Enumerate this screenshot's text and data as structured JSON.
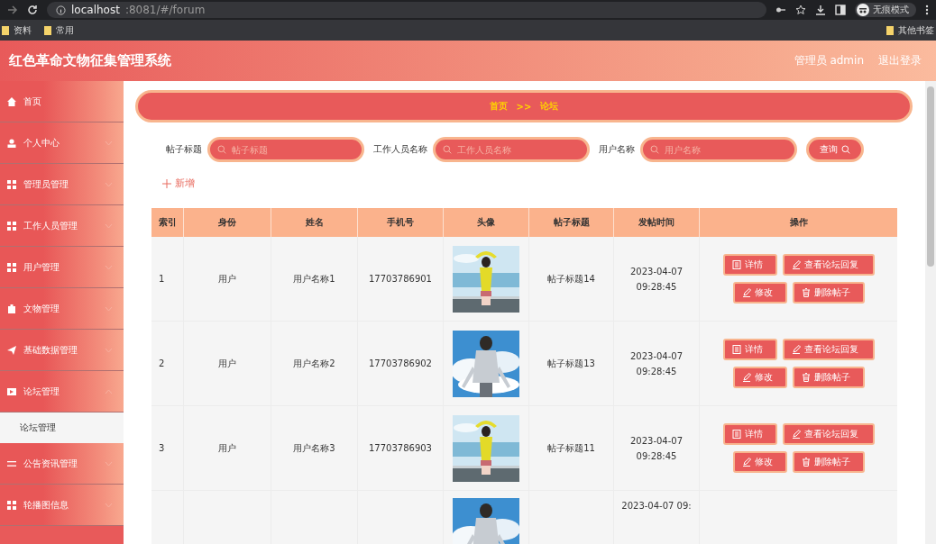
{
  "browser": {
    "url_host": "localhost",
    "url_rest": ":8081/#/forum",
    "mode_label": "无痕模式",
    "bookmarks": [
      "资料",
      "常用"
    ],
    "other_bookmarks": "其他书签"
  },
  "header": {
    "title": "红色革命文物征集管理系统",
    "user": "管理员 admin",
    "logout": "退出登录"
  },
  "sidebar": {
    "items": [
      {
        "label": "首页",
        "has_submenu": false
      },
      {
        "label": "个人中心",
        "has_submenu": true,
        "expanded": false
      },
      {
        "label": "管理员管理",
        "has_submenu": true,
        "expanded": false
      },
      {
        "label": "工作人员管理",
        "has_submenu": true,
        "expanded": false
      },
      {
        "label": "用户管理",
        "has_submenu": true,
        "expanded": false
      },
      {
        "label": "文物管理",
        "has_submenu": true,
        "expanded": false
      },
      {
        "label": "基础数据管理",
        "has_submenu": true,
        "expanded": false
      },
      {
        "label": "论坛管理",
        "has_submenu": true,
        "expanded": true,
        "children": [
          {
            "label": "论坛管理",
            "selected": true
          }
        ]
      },
      {
        "label": "公告资讯管理",
        "has_submenu": true,
        "expanded": false
      },
      {
        "label": "轮播图信息",
        "has_submenu": true,
        "expanded": false
      }
    ]
  },
  "breadcrumb": {
    "items": [
      "首页",
      "论坛"
    ],
    "separator": ">>"
  },
  "search": {
    "fields": [
      {
        "label": "帖子标题",
        "placeholder": "帖子标题"
      },
      {
        "label": "工作人员名称",
        "placeholder": "工作人员名称"
      },
      {
        "label": "用户名称",
        "placeholder": "用户名称"
      }
    ],
    "button": "查询"
  },
  "add_button": "新增",
  "table": {
    "columns": [
      "索引",
      "身份",
      "姓名",
      "手机号",
      "头像",
      "帖子标题",
      "发帖时间",
      "操作"
    ],
    "rows": [
      {
        "index": "1",
        "role": "用户",
        "name": "用户名称1",
        "phone": "17703786901",
        "title": "帖子标题14",
        "time": "2023-04-07 09:28:45",
        "actions": [
          "详情",
          "查看论坛回复",
          "修改",
          "删除帖子"
        ]
      },
      {
        "index": "2",
        "role": "用户",
        "name": "用户名称2",
        "phone": "17703786902",
        "title": "帖子标题13",
        "time": "2023-04-07 09:28:45",
        "actions": [
          "详情",
          "查看论坛回复",
          "修改",
          "删除帖子"
        ]
      },
      {
        "index": "3",
        "role": "用户",
        "name": "用户名称3",
        "phone": "17703786903",
        "title": "帖子标题11",
        "time": "2023-04-07 09:28:45",
        "actions": [
          "详情",
          "查看论坛回复",
          "修改",
          "删除帖子"
        ]
      },
      {
        "time": "2023-04-07 09:"
      }
    ]
  }
}
